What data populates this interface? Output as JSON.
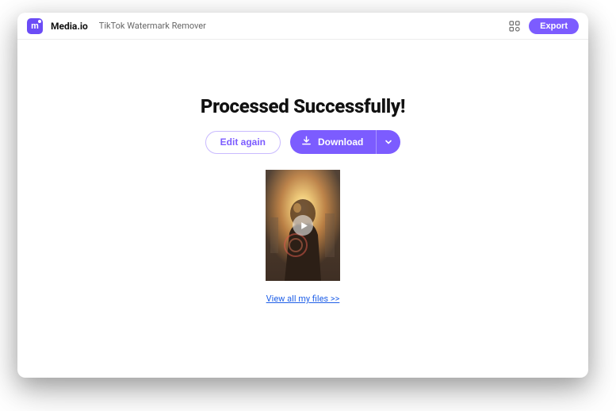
{
  "header": {
    "brand": "Media.io",
    "tool": "TikTok Watermark Remover",
    "export_label": "Export"
  },
  "main": {
    "title": "Processed Successfully!",
    "edit_again_label": "Edit again",
    "download_label": "Download",
    "view_files_label": "View all my files >>"
  },
  "colors": {
    "accent": "#7c5cff"
  }
}
